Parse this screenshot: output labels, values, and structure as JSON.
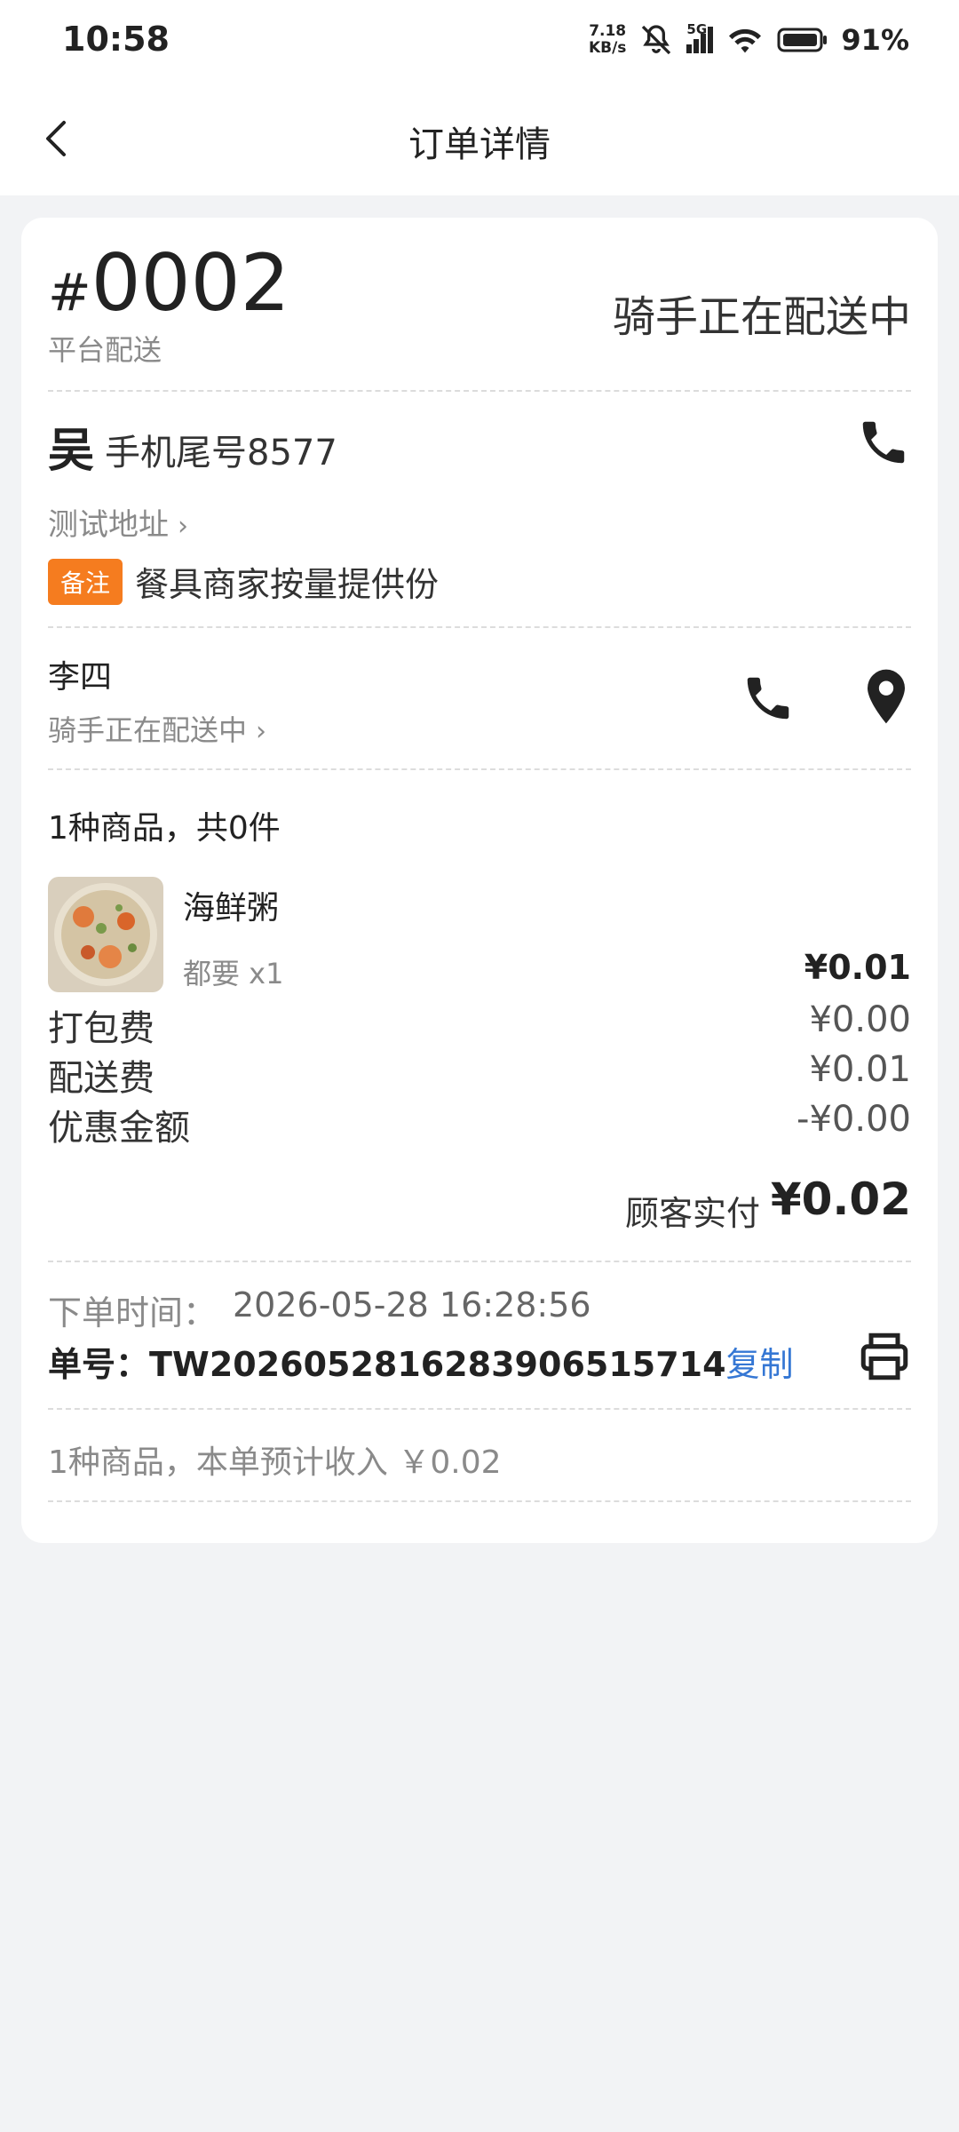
{
  "status_bar": {
    "time": "10:58",
    "net_speed_value": "7.18",
    "net_speed_unit": "KB/s",
    "network": "5G",
    "battery": "91%"
  },
  "header": {
    "title": "订单详情"
  },
  "order": {
    "hash": "#",
    "number": "0002",
    "delivery_type": "平台配送",
    "status": "骑手正在配送中"
  },
  "customer": {
    "surname": "吴",
    "phone_tail": "手机尾号8577",
    "address": "测试地址",
    "remark_badge": "备注",
    "remark_text": "餐具商家按量提供份"
  },
  "rider": {
    "name": "李四",
    "status": "骑手正在配送中"
  },
  "goods": {
    "summary": "1种商品，共0件",
    "items": [
      {
        "name": "海鲜粥",
        "spec": "都要 x1",
        "price": "¥0.01"
      }
    ]
  },
  "fees": [
    {
      "label": "打包费",
      "value": "¥0.00"
    },
    {
      "label": "配送费",
      "value": "¥0.01"
    },
    {
      "label": "优惠金额",
      "value": "-¥0.00"
    }
  ],
  "payment": {
    "label": "顾客实付",
    "value": "¥0.02"
  },
  "meta": {
    "order_time_label": "下单时间：",
    "order_time_value": "2026-05-28 16:28:56",
    "order_number": "单号：TW20260528162839065157​14",
    "copy_label": "复制"
  },
  "income": "1种商品，本单预计收入 ￥0.02",
  "colors": {
    "accent_orange": "#f57c1f",
    "link_blue": "#3577d4"
  },
  "icons": [
    "back-icon",
    "phone-icon",
    "location-icon",
    "printer-icon",
    "chevron-right-icon"
  ]
}
